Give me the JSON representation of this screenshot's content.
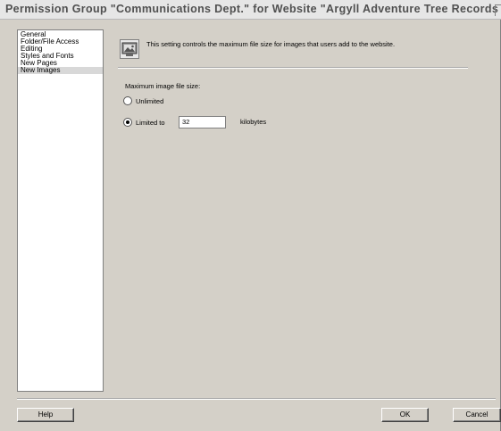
{
  "window": {
    "title": "Permission Group \"Communications Dept.\" for Website \"Argyll Adventure Tree Records Local\""
  },
  "sidebar": {
    "items": [
      {
        "label": "General",
        "selected": false
      },
      {
        "label": "Folder/File Access",
        "selected": false
      },
      {
        "label": "Editing",
        "selected": false
      },
      {
        "label": "Styles and Fonts",
        "selected": false
      },
      {
        "label": "New Pages",
        "selected": false
      },
      {
        "label": "New Images",
        "selected": true
      }
    ]
  },
  "panel": {
    "icon": "image-permission-icon",
    "description": "This setting controls the maximum file size for images that users add to the website.",
    "field_label": "Maximum image file size:",
    "options": [
      {
        "label": "Unlimited",
        "checked": false
      },
      {
        "label": "Limited to",
        "checked": true
      }
    ],
    "size_value": "32",
    "unit": "kilobytes"
  },
  "buttons": {
    "help": "Help",
    "ok": "OK",
    "cancel": "Cancel"
  },
  "colors": {
    "dialog_bg": "#d4d0c8",
    "list_bg": "#ffffff",
    "selection_bg": "#d8d8d8"
  }
}
